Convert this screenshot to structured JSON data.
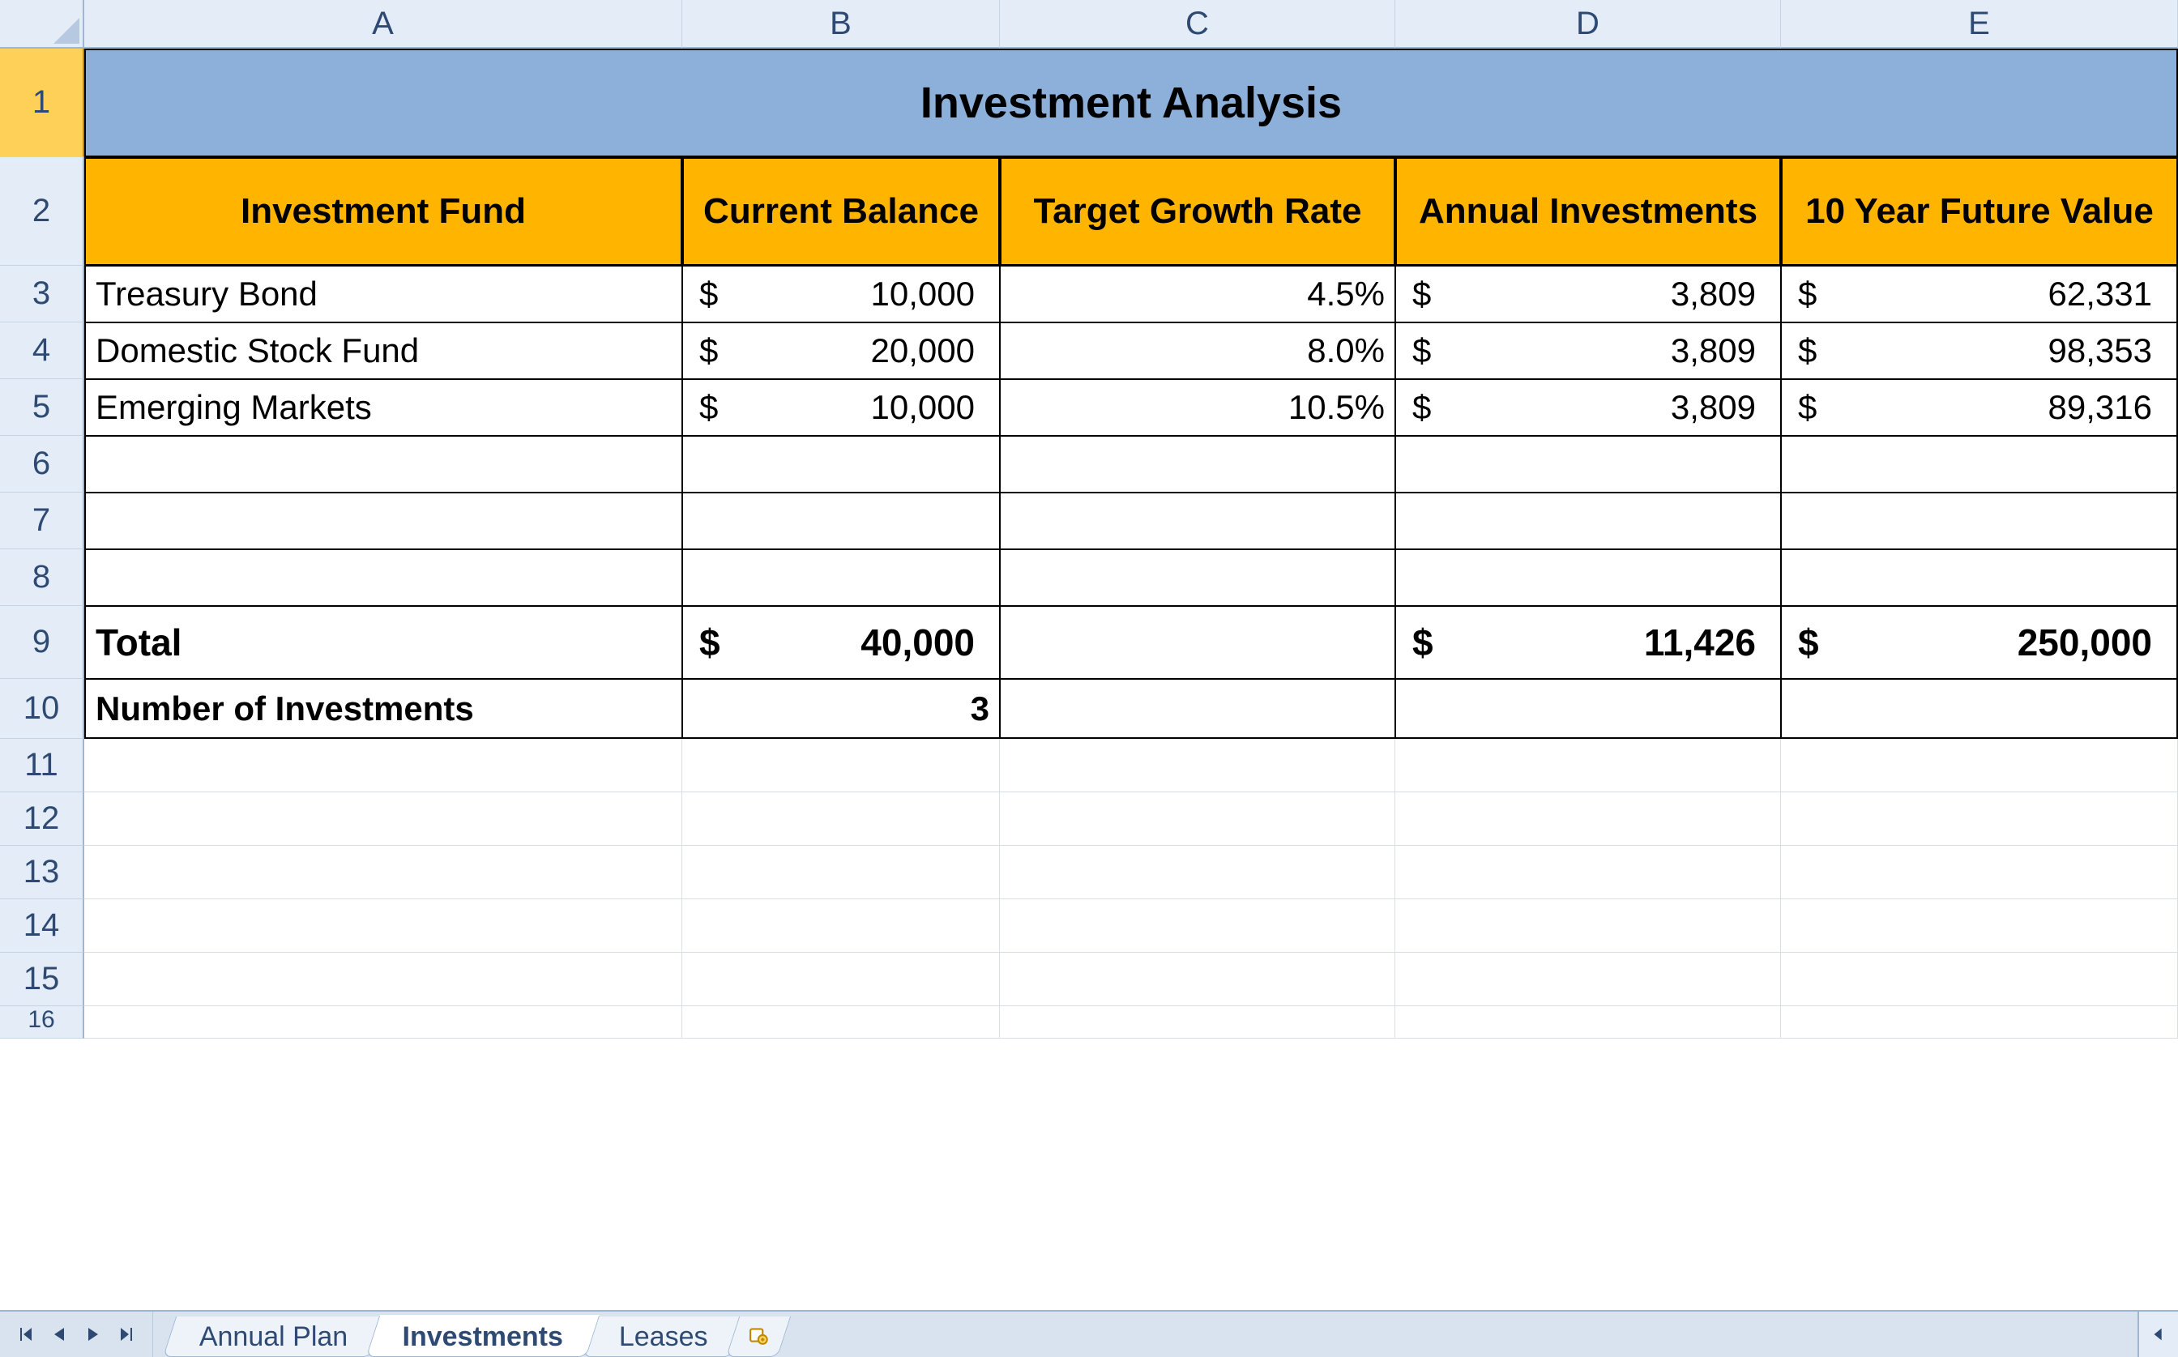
{
  "columns": [
    "A",
    "B",
    "C",
    "D",
    "E"
  ],
  "rows": [
    "1",
    "2",
    "3",
    "4",
    "5",
    "6",
    "7",
    "8",
    "9",
    "10",
    "11",
    "12",
    "13",
    "14",
    "15",
    "16"
  ],
  "title": "Investment Analysis",
  "headers": {
    "a": "Investment Fund",
    "b": "Current Balance",
    "c": "Target Growth Rate",
    "d": "Annual Investments",
    "e": "10 Year Future Value"
  },
  "data": [
    {
      "fund": "Treasury Bond",
      "balance": "10,000",
      "rate": "4.5%",
      "annual": "3,809",
      "future": "62,331"
    },
    {
      "fund": "Domestic Stock Fund",
      "balance": "20,000",
      "rate": "8.0%",
      "annual": "3,809",
      "future": "98,353"
    },
    {
      "fund": "Emerging Markets",
      "balance": "10,000",
      "rate": "10.5%",
      "annual": "3,809",
      "future": "89,316"
    }
  ],
  "total": {
    "label": "Total",
    "balance": "40,000",
    "annual": "11,426",
    "future": "250,000"
  },
  "count": {
    "label": "Number of Investments",
    "value": "3"
  },
  "currency_symbol": "$",
  "tabs": {
    "t1": "Annual Plan",
    "t2": "Investments",
    "t3": "Leases"
  },
  "active_tab": "Investments"
}
